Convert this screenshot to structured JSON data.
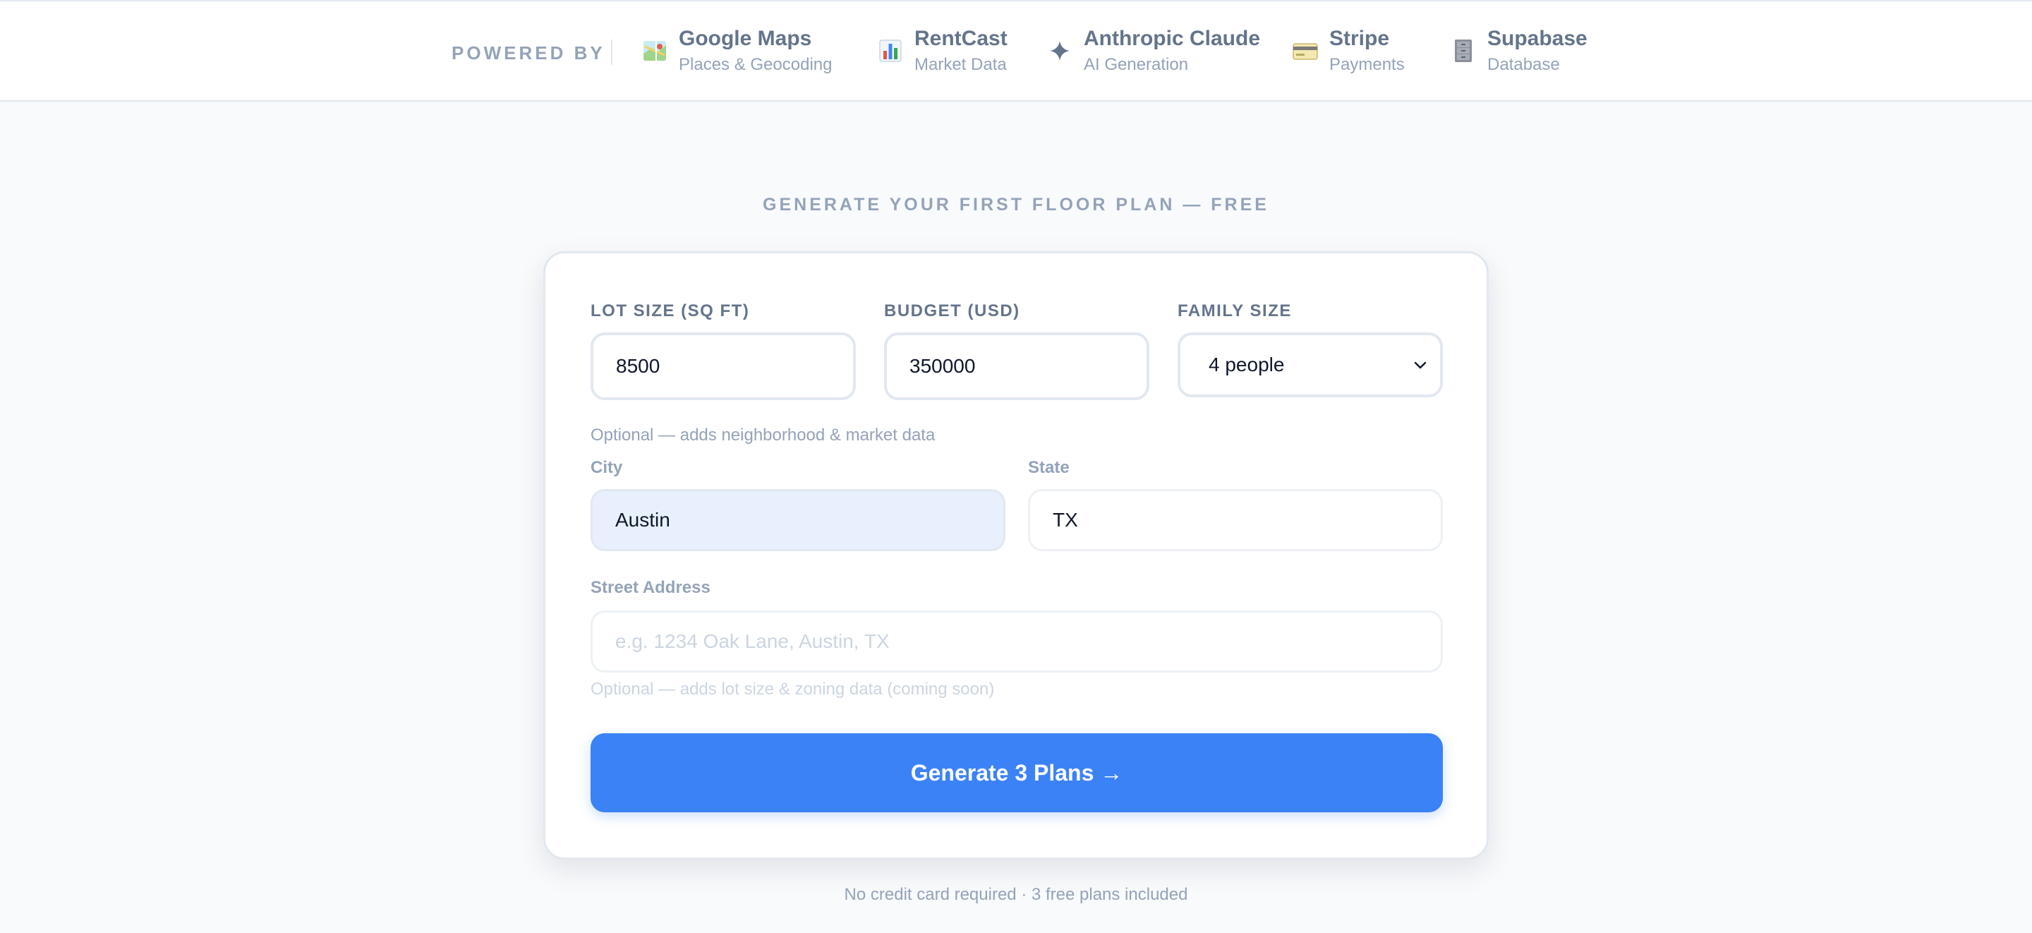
{
  "powered_by": {
    "label": "POWERED BY",
    "providers": [
      {
        "name": "Google Maps",
        "sub": "Places & Geocoding",
        "icon": "map-icon"
      },
      {
        "name": "RentCast",
        "sub": "Market Data",
        "icon": "bar-chart-icon"
      },
      {
        "name": "Anthropic Claude",
        "sub": "AI Generation",
        "icon": "sparkle-icon"
      },
      {
        "name": "Stripe",
        "sub": "Payments",
        "icon": "credit-card-icon"
      },
      {
        "name": "Supabase",
        "sub": "Database",
        "icon": "file-cabinet-icon"
      }
    ]
  },
  "heading": "GENERATE YOUR FIRST FLOOR PLAN — FREE",
  "form": {
    "lot_size": {
      "label": "LOT SIZE (SQ FT)",
      "value": "8500"
    },
    "budget": {
      "label": "BUDGET (USD)",
      "value": "350000"
    },
    "family_size": {
      "label": "FAMILY SIZE",
      "value": "4 people"
    },
    "location_hint": "Optional — adds neighborhood & market data",
    "city": {
      "label": "City",
      "value": "Austin"
    },
    "state": {
      "label": "State",
      "value": "TX"
    },
    "street": {
      "label": "Street Address",
      "placeholder": "e.g. 1234 Oak Lane, Austin, TX",
      "value": ""
    },
    "street_hint": "Optional — adds lot size & zoning data (coming soon)",
    "submit_label": "Generate 3 Plans →"
  },
  "footer_note": "No credit card required · 3 free plans included",
  "colors": {
    "accent": "#3b82f6",
    "page_background": "#f8fafc",
    "muted_text": "#94a3b8",
    "autofill_background": "#e8f0fe"
  }
}
